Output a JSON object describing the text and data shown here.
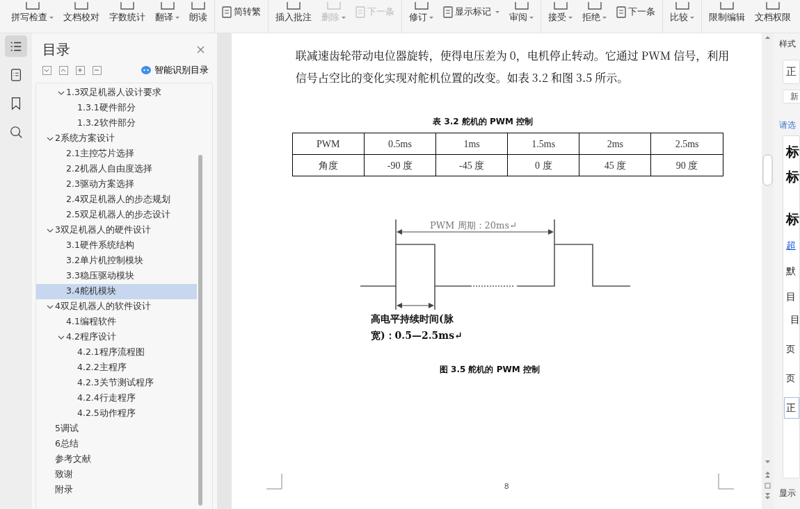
{
  "toolbar": {
    "groups": [
      {
        "items": [
          {
            "label": "拼写检查",
            "kind": "large",
            "dropdown": true,
            "disabled": false
          },
          {
            "label": "文档校对",
            "kind": "large",
            "dropdown": false,
            "disabled": false
          },
          {
            "label": "字数统计",
            "kind": "large",
            "dropdown": false,
            "disabled": false
          },
          {
            "label": "翻译",
            "kind": "large",
            "dropdown": true,
            "disabled": false
          },
          {
            "label": "朗读",
            "kind": "large",
            "dropdown": false,
            "disabled": false
          }
        ]
      },
      {
        "items": [
          {
            "label": "简转繁",
            "kind": "small",
            "dropdown": false,
            "disabled": false
          }
        ]
      },
      {
        "items": [
          {
            "label": "插入批注",
            "kind": "large",
            "dropdown": false,
            "disabled": false
          },
          {
            "label": "删除",
            "kind": "large",
            "dropdown": true,
            "disabled": true
          },
          {
            "label": "下一条",
            "kind": "small",
            "dropdown": false,
            "disabled": true
          }
        ]
      },
      {
        "items": [
          {
            "label": "修订",
            "kind": "large",
            "dropdown": true,
            "disabled": false
          },
          {
            "label": "显示标记",
            "kind": "small",
            "dropdown": true,
            "disabled": false
          },
          {
            "label": "审阅",
            "kind": "large",
            "dropdown": true,
            "disabled": false
          }
        ]
      },
      {
        "items": [
          {
            "label": "接受",
            "kind": "large",
            "dropdown": true,
            "disabled": false
          },
          {
            "label": "拒绝",
            "kind": "large",
            "dropdown": true,
            "disabled": false
          },
          {
            "label": "下一条",
            "kind": "small",
            "dropdown": false,
            "disabled": false
          }
        ]
      },
      {
        "items": [
          {
            "label": "比较",
            "kind": "large",
            "dropdown": true,
            "disabled": false
          }
        ]
      },
      {
        "items": [
          {
            "label": "限制编辑",
            "kind": "large",
            "dropdown": false,
            "disabled": false
          },
          {
            "label": "文档权限",
            "kind": "large",
            "dropdown": false,
            "disabled": false
          }
        ]
      }
    ]
  },
  "rail": [
    {
      "selected": true
    },
    {
      "selected": false
    },
    {
      "selected": false
    },
    {
      "selected": false
    }
  ],
  "toc": {
    "title": "目录",
    "smart_button": "智能识别目录",
    "continued": [
      {
        "label": "1.3双足机器人设计要求",
        "expanded": true,
        "selected": false,
        "children": [
          {
            "label": "1.3.1硬件部分",
            "selected": false
          },
          {
            "label": "1.3.2软件部分",
            "selected": false
          }
        ]
      }
    ],
    "items": [
      {
        "label": "2系统方案设计",
        "expanded": true,
        "selected": false,
        "children": [
          {
            "label": "2.1主控芯片选择",
            "selected": false
          },
          {
            "label": "2.2机器人自由度选择",
            "selected": false
          },
          {
            "label": "2.3驱动方案选择",
            "selected": false
          },
          {
            "label": "2.4双足机器人的步态规划",
            "selected": false
          },
          {
            "label": "2.5双足机器人的步态设计",
            "selected": false
          }
        ]
      },
      {
        "label": "3双足机器人的硬件设计",
        "expanded": true,
        "selected": false,
        "children": [
          {
            "label": "3.1硬件系统结构",
            "selected": false
          },
          {
            "label": "3.2单片机控制模块",
            "selected": false
          },
          {
            "label": "3.3稳压驱动模块",
            "selected": false
          },
          {
            "label": "3.4舵机模块",
            "selected": true
          }
        ]
      },
      {
        "label": "4双足机器人的软件设计",
        "expanded": true,
        "selected": false,
        "children": [
          {
            "label": "4.1编程软件",
            "selected": false
          },
          {
            "label": "4.2程序设计",
            "expanded": true,
            "selected": false,
            "children": [
              {
                "label": "4.2.1程序流程图",
                "selected": false
              },
              {
                "label": "4.2.2主程序",
                "selected": false
              },
              {
                "label": "4.2.3关节测试程序",
                "selected": false
              },
              {
                "label": "4.2.4行走程序",
                "selected": false
              },
              {
                "label": "4.2.5动作程序",
                "selected": false
              }
            ]
          }
        ]
      },
      {
        "label": "5调试",
        "selected": false
      },
      {
        "label": "6总结",
        "selected": false
      },
      {
        "label": "参考文献",
        "selected": false
      },
      {
        "label": "致谢",
        "selected": false
      },
      {
        "label": "附录",
        "selected": false
      }
    ]
  },
  "document": {
    "paragraph_lines": [
      "联减速齿轮带动电位器旋转，使得电压差为 0，电机停止转动。它通过 PWM 信号，利用",
      "信号占空比的变化实现对舵机位置的改变。如表 3.2 和图 3.5 所示。"
    ],
    "table": {
      "caption": "表 3.2 舵机的 PWM 控制",
      "rows": [
        [
          "PWM",
          "0.5ms",
          "1ms",
          "1.5ms",
          "2ms",
          "2.5ms"
        ],
        [
          "角度",
          "-90 度",
          "-45 度",
          "0 度",
          "45 度",
          "90 度"
        ]
      ]
    },
    "figure": {
      "period_label": "PWM 周期：20ms↵",
      "pulse_label_lines": [
        "高电平持续时间(脉",
        "宽)：0.5—2.5ms↵"
      ],
      "caption": "图 3.5 舵机的 PWM 控制"
    },
    "page_number": "8"
  },
  "styles_panel": {
    "title": "样式",
    "current_style": "正",
    "new_button": "新",
    "hint": "请选",
    "entries": [
      {
        "label": "标",
        "kind": "heading"
      },
      {
        "label": "标",
        "kind": "heading"
      },
      {
        "label": "标",
        "kind": "heading"
      },
      {
        "label": "超",
        "kind": "link"
      },
      {
        "label": "默",
        "kind": "plain"
      },
      {
        "label": "目",
        "kind": "plain"
      },
      {
        "label": "目",
        "kind": "indent"
      },
      {
        "label": "页",
        "kind": "small"
      },
      {
        "label": "页",
        "kind": "small"
      },
      {
        "label": "正",
        "kind": "current"
      }
    ],
    "footer": "显示"
  }
}
